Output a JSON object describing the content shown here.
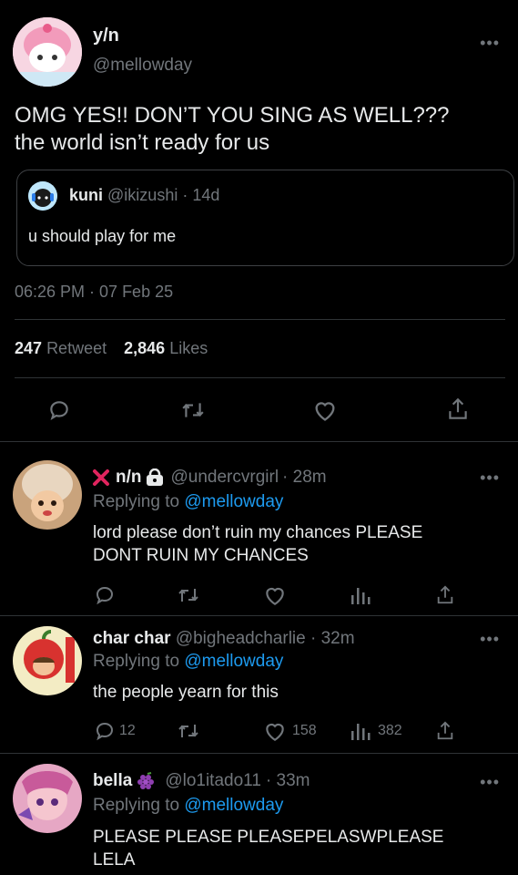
{
  "main_tweet": {
    "display_name": "y/n",
    "handle": "@mellowday",
    "text_line1": "OMG YES!! DON’T YOU SING AS WELL???",
    "text_line2": "the world isn’t ready for us",
    "quote": {
      "display_name": "kuni",
      "handle": "@ikizushi",
      "sep": "·",
      "time": "14d",
      "text": "u should play for me"
    },
    "timestamp": "06:26 PM · 07 Feb 25",
    "retweets_count": "247",
    "retweets_label": "Retweet",
    "likes_count": "2,846",
    "likes_label": "Likes"
  },
  "replies": [
    {
      "display_name": "n/n",
      "handle": "@undercvrgirl",
      "time": "· 28m",
      "replying_prefix": "Replying to",
      "replying_to": "@mellowday",
      "text_line1": "lord please don’t ruin my chances PLEASE",
      "text_line2": "DONT RUIN MY CHANCES"
    },
    {
      "display_name": "char char",
      "handle": "@bigheadcharlie",
      "time": "· 32m",
      "replying_prefix": "Replying to",
      "replying_to": "@mellowday",
      "text_line1": "the people yearn for this",
      "reply_count": "12",
      "like_count": "158",
      "view_count": "382"
    },
    {
      "display_name": "bella",
      "handle": "@lo1itado11",
      "time": "· 33m",
      "replying_prefix": "Replying to",
      "replying_to": "@mellowday",
      "text_line1": "PLEASE PLEASE PLEASEPELASWPLEASE",
      "text_line2": "LELA"
    }
  ],
  "icons": [
    "more-icon",
    "reply-icon",
    "retweet-icon",
    "like-icon",
    "share-icon",
    "views-icon",
    "lock-icon",
    "cross-icon",
    "grapes-icon"
  ],
  "colors": {
    "background": "#000000",
    "text": "#e7e9ea",
    "muted": "#71767b",
    "link": "#1d9bf0",
    "divider": "#2f3336"
  }
}
